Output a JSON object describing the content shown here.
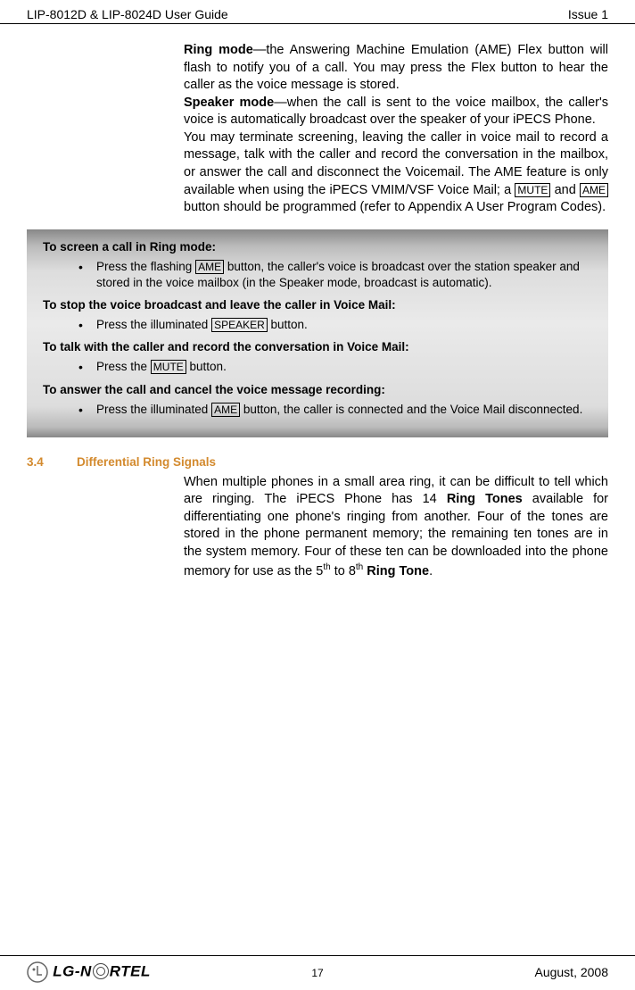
{
  "header": {
    "left": "LIP-8012D & LIP-8024D User Guide",
    "right": "Issue 1"
  },
  "intro": {
    "ring_mode_label": "Ring mode",
    "ring_mode_text": "—the Answering Machine Emulation (AME) Flex button will flash to notify you of a call.  You may press the Flex button to hear the caller as the voice message is stored.",
    "speaker_mode_label": "Speaker mode",
    "speaker_mode_text": "—when the call is sent to the voice mailbox, the caller's voice is automatically broadcast over the speaker of your iPECS Phone.",
    "para3_before": "You may terminate screening, leaving the caller in voice mail to record a message, talk with the caller and record the conversation in the mailbox, or answer the call and disconnect the Voicemail.  The AME feature is only available when using the iPECS VMIM/VSF Voice Mail; a ",
    "mute_key": "MUTE",
    "para3_mid": " and ",
    "ame_key": "AME",
    "para3_after": " button should be programmed (refer to Appendix A User Program Codes)."
  },
  "box": {
    "title1": "To screen a call in Ring mode:",
    "item1_before": "Press the flashing ",
    "item1_key": "AME",
    "item1_after": " button, the caller's voice is broadcast over the station speaker and stored in the voice mailbox (in the Speaker mode, broadcast is automatic).",
    "title2": "To stop the voice broadcast and leave the caller in Voice Mail:",
    "item2_before": "Press the illuminated ",
    "item2_key": "SPEAKER",
    "item2_after": " button.",
    "title3": "To talk with the caller and record the conversation in Voice Mail:",
    "item3_before": "Press the ",
    "item3_key": "MUTE",
    "item3_after": " button.",
    "title4": "To answer the call and cancel the voice message recording:",
    "item4_before": "Press the illuminated ",
    "item4_key": "AME",
    "item4_after": " button, the caller is connected and the Voice Mail disconnected."
  },
  "section": {
    "number": "3.4",
    "title": "Differential Ring Signals",
    "text_before": "When multiple phones in a small area ring, it can be difficult to tell which are ringing.  The iPECS Phone has 14 ",
    "bold1": "Ring Tones",
    "text_mid": " available for differentiating one phone's ringing from another.  Four of the tones are stored in the phone permanent memory; the remaining ten tones are in the system memory.  Four of these ten can be downloaded into the phone memory for use as the 5",
    "sup1": "th",
    "text_mid2": " to 8",
    "sup2": "th",
    "space": " ",
    "bold2": "Ring Tone",
    "text_after": "."
  },
  "footer": {
    "logo_text": "LG-N",
    "logo_text2": "RTEL",
    "page": "17",
    "date": "August, 2008"
  }
}
